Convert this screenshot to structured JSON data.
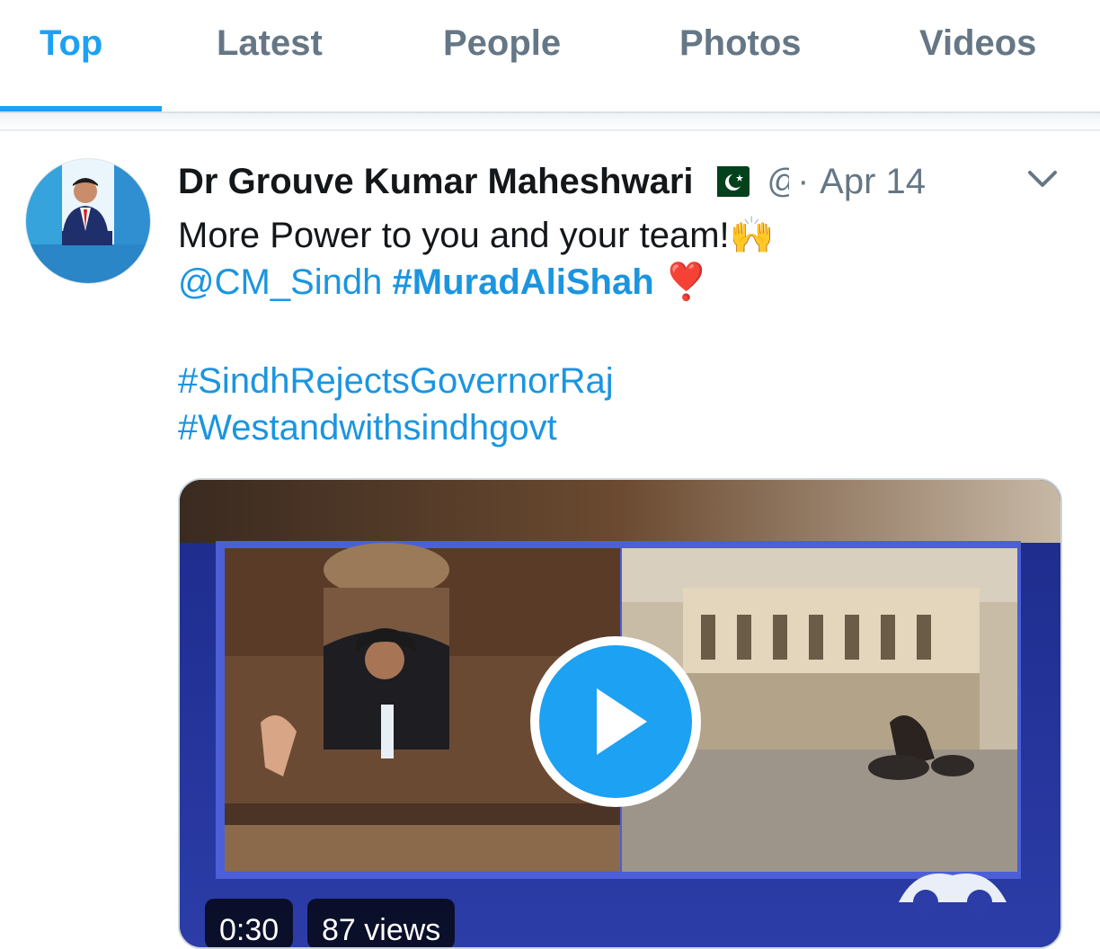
{
  "tabs": [
    {
      "label": "Top",
      "active": true
    },
    {
      "label": "Latest",
      "active": false
    },
    {
      "label": "People",
      "active": false
    },
    {
      "label": "Photos",
      "active": false
    },
    {
      "label": "Videos",
      "active": false
    }
  ],
  "tweet": {
    "author_name": "Dr Grouve Kumar Maheshwari",
    "flag_icon": "pakistan-flag-icon",
    "handle": "@",
    "separator": "·",
    "date": "Apr 14",
    "text_line1": "More Power to you and your team!🙌",
    "mention": "@CM_Sindh",
    "hashtag_bold": "#MuradAliShah",
    "heart_emoji": "❣️",
    "hashtag1": "#SindhRejectsGovernorRaj",
    "hashtag2": "#Westandwithsindhgovt",
    "video": {
      "duration": "0:30",
      "views": "87 views"
    }
  },
  "colors": {
    "accent": "#1da1f2",
    "link": "#1b95e0",
    "muted": "#657786",
    "text": "#14171a"
  }
}
